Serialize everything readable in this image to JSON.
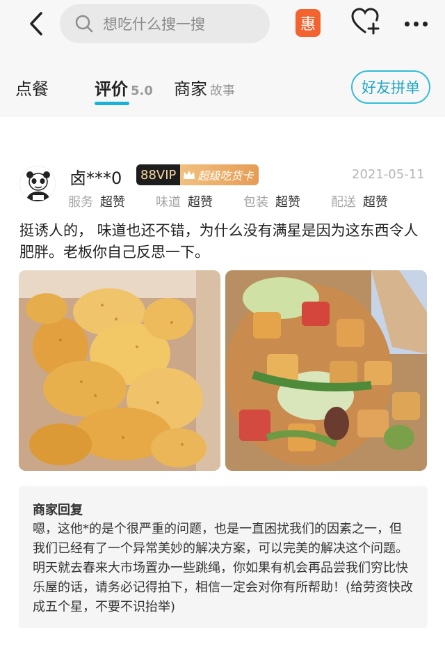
{
  "header": {
    "back_icon": "chevron-left-icon",
    "search_placeholder": "想吃什么搜一搜",
    "coupon_badge": "惠",
    "favorite_icon": "heart-plus-icon",
    "more_icon": "more-dots-icon"
  },
  "tabs": {
    "order": "点餐",
    "reviews": "评价",
    "reviews_score": "5.0",
    "merchant": "商家",
    "merchant_sub": "故事",
    "friend_group_button": "好友拼单",
    "active": "reviews"
  },
  "review": {
    "username": "卤***0",
    "vip_level": "88VIP",
    "vip_badge": "超级吃货卡",
    "date": "2021-05-11",
    "ratings": [
      {
        "label": "服务",
        "value": "超赞"
      },
      {
        "label": "味道",
        "value": "超赞"
      },
      {
        "label": "包装",
        "value": "超赞"
      },
      {
        "label": "配送",
        "value": "超赞"
      }
    ],
    "text": "挺诱人的， 味道也还不错，为什么没有满星是因为这东西令人肥胖。老板你自己反思一下。",
    "photos": [
      "potato-chips-photo",
      "stir-fry-photo"
    ]
  },
  "merchant_reply": {
    "title": "商家回复",
    "text": "嗯，这他*的是个很严重的问题，也是一直困扰我们的因素之一，但我们已经有了一个异常美妙的解决方案，可以完美的解决这个问题。明天就去春来大市场置办一些跳绳，你如果有机会再品尝我们穷比快乐屋的话，请务必记得拍下，相信一定会对你有所帮助！(给劳资快改成五个星，不要不识抬举)"
  },
  "colors": {
    "accent": "#17b3d4",
    "coupon": "#f3632f",
    "vip_gold": "#e9a25c"
  }
}
